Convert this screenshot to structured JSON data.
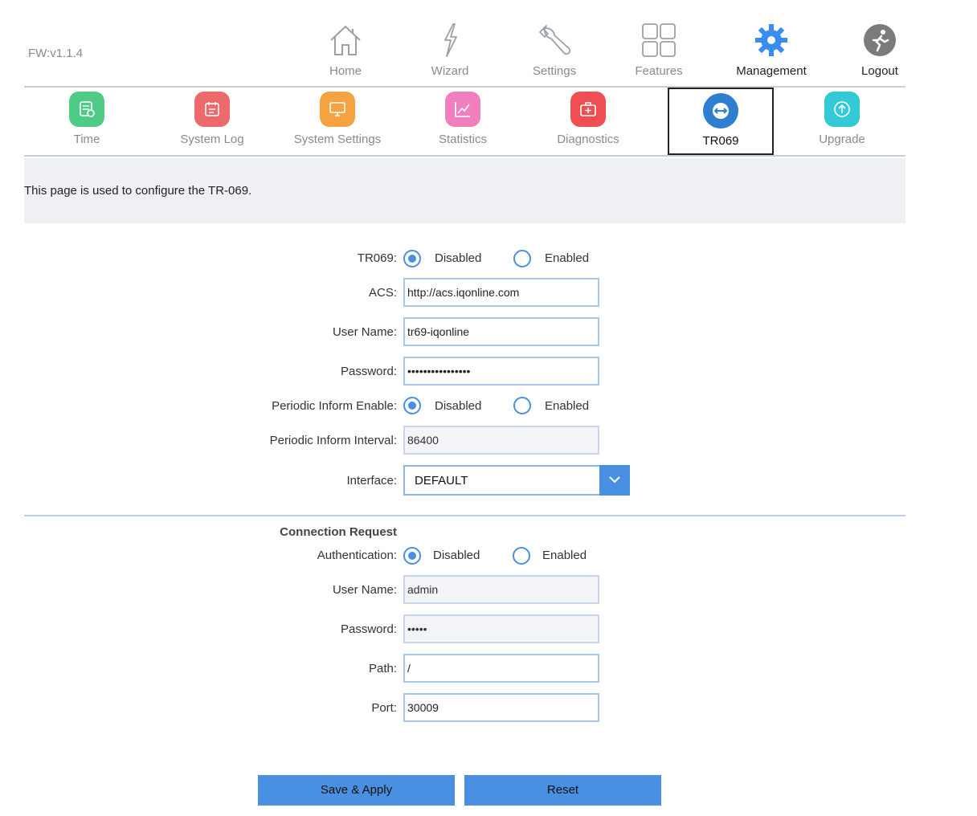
{
  "firmware": "FW:v1.1.4",
  "topnav": {
    "home": "Home",
    "wizard": "Wizard",
    "settings": "Settings",
    "features": "Features",
    "management": "Management",
    "logout": "Logout",
    "active": "management"
  },
  "subnav": {
    "time": "Time",
    "system_log": "System Log",
    "system_settings": "System Settings",
    "statistics": "Statistics",
    "diagnostics": "Diagnostics",
    "tr069": "TR069",
    "upgrade": "Upgrade",
    "active": "tr069",
    "colors": {
      "time": "#4ecb85",
      "system_log": "#ee6a6a",
      "system_settings": "#f4a340",
      "statistics": "#f07fbd",
      "diagnostics": "#ef4e52",
      "tr069": "#2f7fd0",
      "upgrade": "#33c9d6"
    }
  },
  "info_text": "This page is used to configure the TR-069.",
  "form": {
    "tr069": {
      "label": "TR069:",
      "disabled": "Disabled",
      "enabled": "Enabled",
      "selected": "Disabled"
    },
    "acs": {
      "label": "ACS:",
      "value": "http://acs.iqonline.com"
    },
    "username": {
      "label": "User Name:",
      "value": "tr69-iqonline"
    },
    "password": {
      "label": "Password:",
      "value": "••••••••••••••••"
    },
    "periodic_enable": {
      "label": "Periodic Inform Enable:",
      "disabled": "Disabled",
      "enabled": "Enabled",
      "selected": "Disabled"
    },
    "periodic_interval": {
      "label": "Periodic Inform Interval:",
      "value": "86400"
    },
    "interface": {
      "label": "Interface:",
      "value": "DEFAULT"
    }
  },
  "connection_request": {
    "title": "Connection Request",
    "authentication": {
      "label": "Authentication:",
      "disabled": "Disabled",
      "enabled": "Enabled",
      "selected": "Disabled"
    },
    "username": {
      "label": "User Name:",
      "value": "admin"
    },
    "password": {
      "label": "Password:",
      "value": "•••••"
    },
    "path": {
      "label": "Path:",
      "value": "/"
    },
    "port": {
      "label": "Port:",
      "value": "30009"
    }
  },
  "buttons": {
    "save": "Save & Apply",
    "reset": "Reset"
  },
  "colors": {
    "accent": "#4a90e2",
    "info_bg": "#eef0f4",
    "management_icon": "#3b8cf0"
  }
}
